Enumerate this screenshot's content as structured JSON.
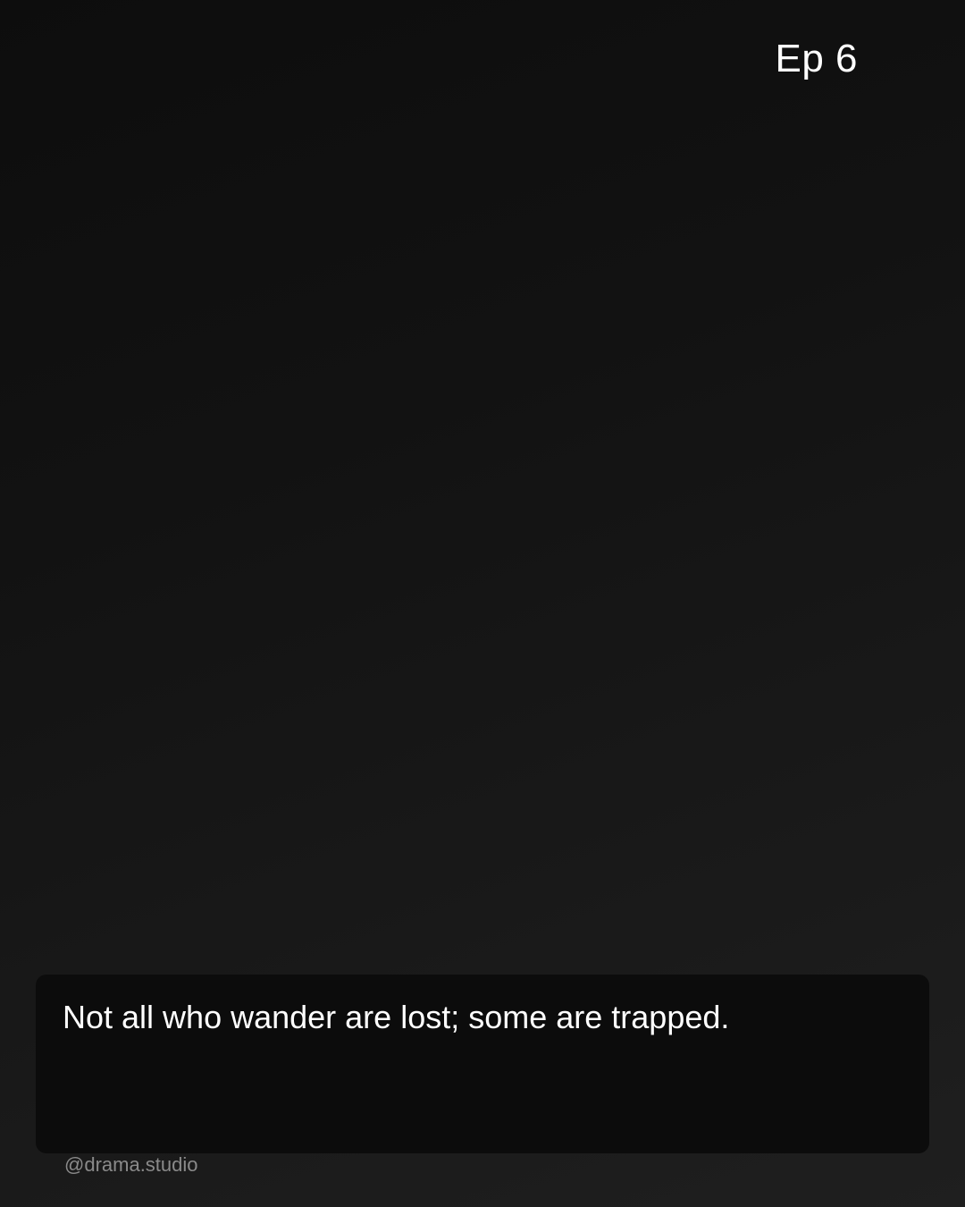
{
  "episode": {
    "label": "Ep 6"
  },
  "caption": {
    "text": "Not all who wander are lost; some are trapped."
  },
  "footer": {
    "handle": "@drama.studio"
  },
  "colors": {
    "background_dark": "#0d0d0d",
    "background_light": "#1f1f1f",
    "caption_box": "#0c0c0c",
    "text_primary": "#ffffff",
    "text_muted": "#8a8a8a"
  }
}
